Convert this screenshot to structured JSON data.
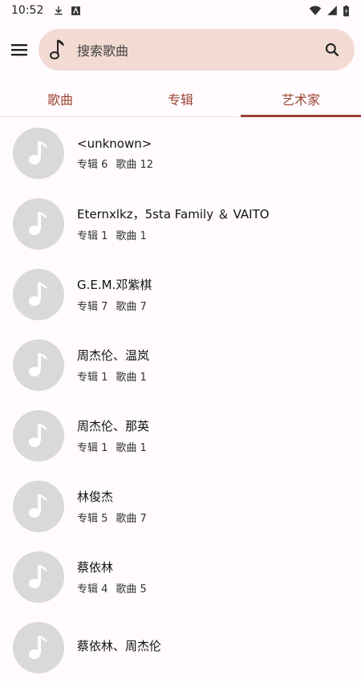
{
  "status_bar": {
    "time": "10:52"
  },
  "search": {
    "placeholder": "搜索歌曲"
  },
  "tabs": [
    {
      "label": "歌曲",
      "active": false
    },
    {
      "label": "专辑",
      "active": false
    },
    {
      "label": "艺术家",
      "active": true
    }
  ],
  "artists": [
    {
      "name": "<unknown>",
      "albums": "专辑 6",
      "songs": "歌曲 12"
    },
    {
      "name": "Eternxlkz，5sta Family ＆ VAITO",
      "albums": "专辑 1",
      "songs": "歌曲 1"
    },
    {
      "name": "G.E.M.邓紫棋",
      "albums": "专辑 7",
      "songs": "歌曲 7"
    },
    {
      "name": "周杰伦、温岚",
      "albums": "专辑 1",
      "songs": "歌曲 1"
    },
    {
      "name": "周杰伦、那英",
      "albums": "专辑 1",
      "songs": "歌曲 1"
    },
    {
      "name": "林俊杰",
      "albums": "专辑 5",
      "songs": "歌曲 7"
    },
    {
      "name": "蔡依林",
      "albums": "专辑 4",
      "songs": "歌曲 5"
    },
    {
      "name": "蔡依林、周杰伦",
      "albums": "",
      "songs": ""
    }
  ],
  "colors": {
    "accent": "#9c4331",
    "search_bg": "#f3dbd4",
    "avatar_bg": "#d9d9d9",
    "background": "#fffbfe"
  }
}
